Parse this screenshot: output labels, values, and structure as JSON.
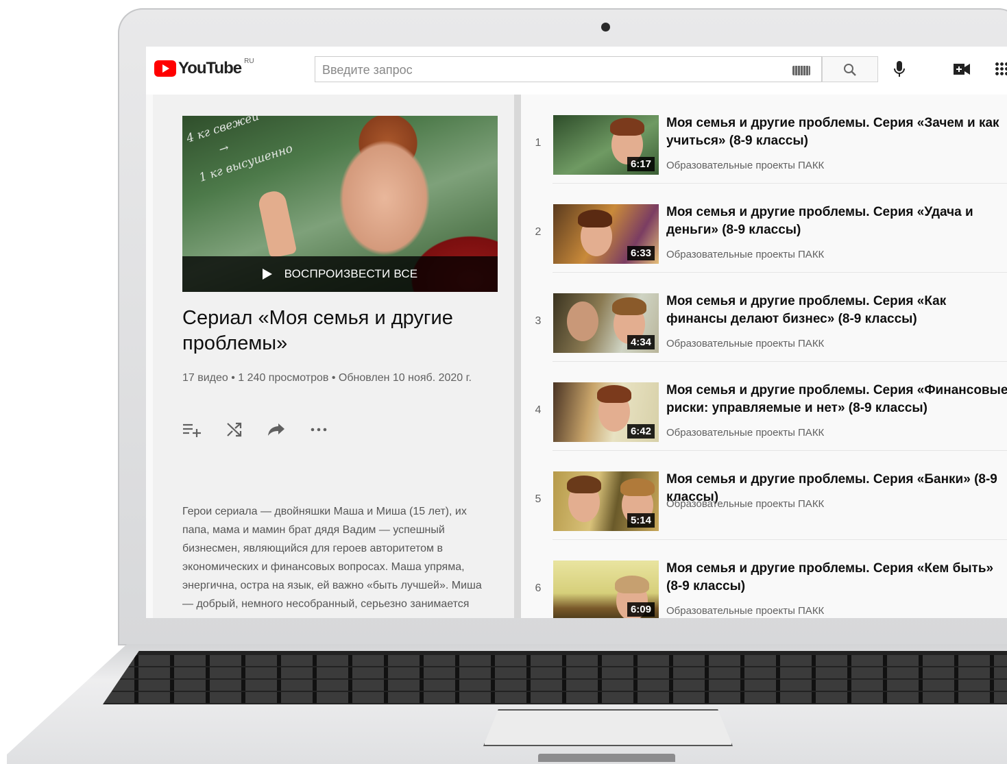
{
  "header": {
    "logo_text": "YouTube",
    "logo_region": "RU",
    "search_placeholder": "Введите запрос"
  },
  "playlist": {
    "play_all_label": "ВОСПРОИЗВЕСТИ ВСЕ",
    "title": "Сериал «Моя семья и другие проблемы»",
    "stats": "17 видео • 1 240 просмотров • Обновлен 10 нояб. 2020 г.",
    "hero_handwriting": [
      "4 кг свежей",
      "→",
      "1 кг высушенно"
    ],
    "description": "Герои сериала — двойняшки Маша и Миша (15 лет), их папа, мама и мамин брат дядя Вадим — успешный бизнесмен, являющийся для героев авторитетом в экономических и финансовых вопросах. Маша упряма, энергична, остра на язык, ей важно «быть лучшей». Миша — добрый, немного несобранный, серьезно занимается хоккеем, ему многое легко удается."
  },
  "videos": [
    {
      "index": "1",
      "title": "Моя семья и другие проблемы. Серия «Зачем и как учиться» (8-9 классы)",
      "channel": "Образовательные проекты ПАКК",
      "duration": "6:17"
    },
    {
      "index": "2",
      "title": "Моя семья и другие проблемы. Серия «Удача и деньги» (8-9 классы)",
      "channel": "Образовательные проекты ПАКК",
      "duration": "6:33"
    },
    {
      "index": "3",
      "title": "Моя семья и другие проблемы. Серия «Как финансы делают бизнес» (8-9 классы)",
      "channel": "Образовательные проекты ПАКК",
      "duration": "4:34"
    },
    {
      "index": "4",
      "title": "Моя семья и другие проблемы. Серия «Финансовые риски: управляемые и нет» (8-9 классы)",
      "channel": "Образовательные проекты ПАКК",
      "duration": "6:42"
    },
    {
      "index": "5",
      "title": "Моя семья и другие проблемы. Серия «Банки» (8-9 классы)",
      "channel": "Образовательные проекты ПАКК",
      "duration": "5:14"
    },
    {
      "index": "6",
      "title": "Моя семья и другие проблемы. Серия «Кем быть» (8-9 классы)",
      "channel": "Образовательные проекты ПАКК",
      "duration": "6:09"
    }
  ],
  "icons": {
    "logo": "youtube-logo-icon",
    "keyboard": "keyboard-icon",
    "search": "search-icon",
    "mic": "microphone-icon",
    "create": "video-create-icon",
    "apps": "apps-grid-icon",
    "add_to_queue": "add-to-queue-icon",
    "shuffle": "shuffle-icon",
    "share": "share-icon",
    "more": "more-horizontal-icon",
    "play": "play-icon"
  },
  "colors": {
    "brand_red": "#ff0000",
    "text_primary": "#0f0f0f",
    "text_secondary": "#606060"
  }
}
